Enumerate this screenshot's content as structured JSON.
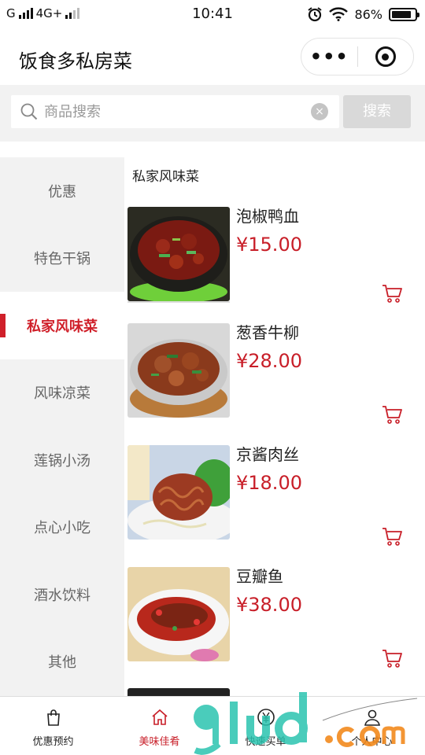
{
  "status_bar": {
    "carrier": "G",
    "network": "4G+",
    "time": "10:41",
    "battery": "86%"
  },
  "navbar": {
    "title": "饭食多私房菜",
    "more_icon": "ellipsis-icon",
    "close_icon": "target-icon"
  },
  "search": {
    "placeholder": "商品搜索",
    "button_label": "搜索"
  },
  "sidebar": {
    "categories": [
      {
        "label": "优惠",
        "active": false
      },
      {
        "label": "特色干锅",
        "active": false
      },
      {
        "label": "私家风味菜",
        "active": true
      },
      {
        "label": "风味凉菜",
        "active": false
      },
      {
        "label": "莲锅小汤",
        "active": false
      },
      {
        "label": "点心小吃",
        "active": false
      },
      {
        "label": "酒水饮料",
        "active": false
      },
      {
        "label": "其他",
        "active": false
      }
    ]
  },
  "main": {
    "section_title": "私家风味菜",
    "items": [
      {
        "name": "泡椒鸭血",
        "price": "¥15.00"
      },
      {
        "name": "葱香牛柳",
        "price": "¥28.00"
      },
      {
        "name": "京酱肉丝",
        "price": "¥18.00"
      },
      {
        "name": "豆瓣鱼",
        "price": "¥38.00"
      }
    ]
  },
  "tabbar": {
    "tabs": [
      {
        "label": "优惠预约",
        "icon": "shopping-bag-icon",
        "active": false
      },
      {
        "label": "美味佳肴",
        "icon": "home-icon",
        "active": true
      },
      {
        "label": "快速买单",
        "icon": "yen-coin-icon",
        "active": false
      },
      {
        "label": "个人中心",
        "icon": "user-icon",
        "active": false
      }
    ]
  },
  "colors": {
    "accent": "#c81e28",
    "sidebar_bg": "#f2f2f2"
  }
}
